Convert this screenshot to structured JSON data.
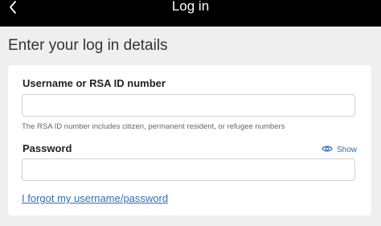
{
  "header": {
    "title": "Log in",
    "back_icon": "chevron-left-icon"
  },
  "page": {
    "heading": "Enter your log in details"
  },
  "form": {
    "username": {
      "label": "Username or RSA ID number",
      "value": "",
      "placeholder": "",
      "hint": "The RSA ID number includes citizen, permanent resident, or refugee numbers"
    },
    "password": {
      "label": "Password",
      "value": "",
      "placeholder": "",
      "show_label": "Show",
      "show_icon": "eye-icon"
    },
    "forgot_link": "I forgot my username/password"
  },
  "colors": {
    "header_bg": "#000000",
    "page_bg": "#efefef",
    "card_bg": "#ffffff",
    "link": "#2f6fb5"
  }
}
